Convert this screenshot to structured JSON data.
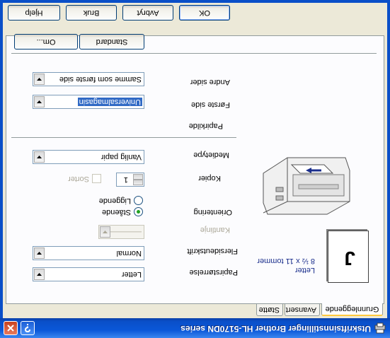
{
  "window": {
    "title": "Utskriftsinnstillinger Brother HL-5170DN series",
    "help_button": "?",
    "close_button": "X"
  },
  "tabs": [
    {
      "label": "Grunnleggende",
      "active": true
    },
    {
      "label": "Avansert",
      "active": false
    },
    {
      "label": "Støtte",
      "active": false
    }
  ],
  "preview": {
    "page_glyph": "J",
    "paper_name": "Letter",
    "paper_dims": "8 ½ x 11 tommer"
  },
  "settings": {
    "paper_size": {
      "label": "Papirstørrelse",
      "value": "Letter"
    },
    "multi_page": {
      "label": "Flersideutskrift",
      "value": "Normal"
    },
    "border_line": {
      "label": "Kantlinje",
      "value": "————"
    },
    "orientation": {
      "label": "Orientering",
      "options": [
        {
          "label": "Stående",
          "selected": true
        },
        {
          "label": "Liggende",
          "selected": false
        }
      ]
    },
    "copies": {
      "label": "Kopier",
      "value": "1",
      "collate_label": "Sorter"
    },
    "media_type": {
      "label": "Medietype",
      "value": "Vanlig papir"
    },
    "paper_source": {
      "label": "Papirkilde"
    },
    "first_page": {
      "label": "Første side",
      "value": "Universalmagasin"
    },
    "other_pages": {
      "label": "Andre sider",
      "value": "Samme som første side"
    }
  },
  "buttons": {
    "default": "Standard",
    "about": "Om...",
    "ok": "OK",
    "cancel": "Avbryt",
    "apply": "Bruk",
    "help": "Hjelp"
  },
  "colors": {
    "titlebar": "#0a57d8",
    "dialog_bg": "#ece9d8",
    "selection": "#316ac5"
  }
}
